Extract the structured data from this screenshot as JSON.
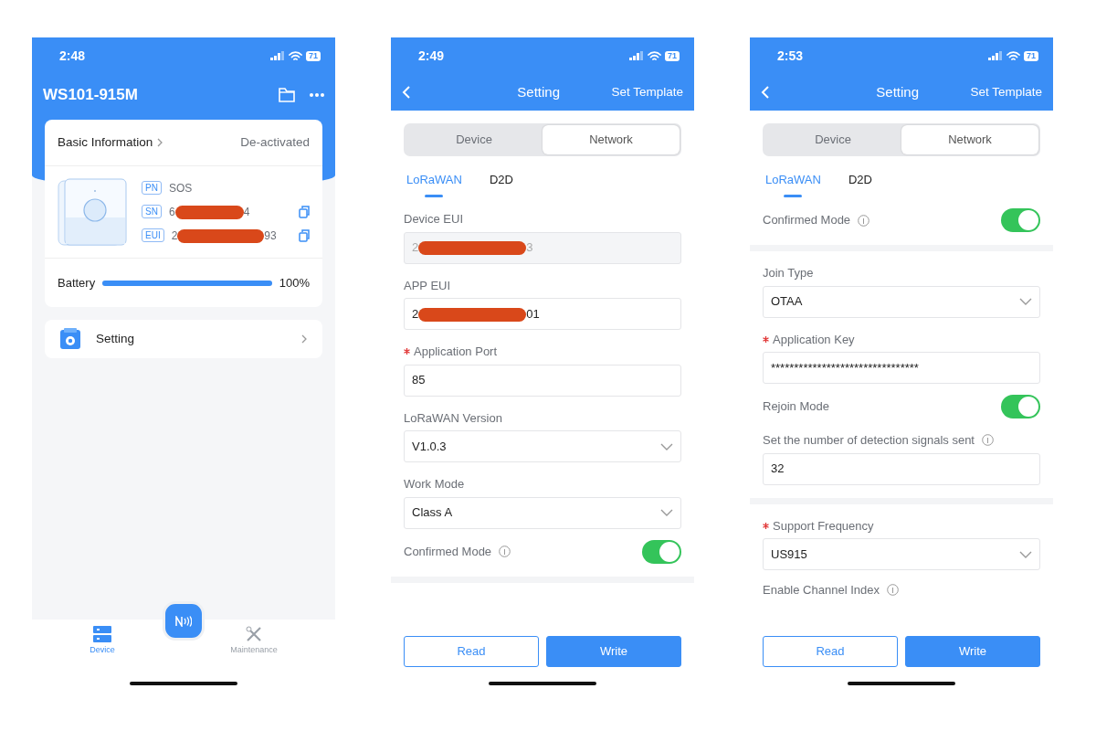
{
  "screens": [
    {
      "kind": "device",
      "status_bar": {
        "time": "2:48",
        "battery": "71"
      },
      "title": "WS101-915M",
      "info_card": {
        "heading": "Basic Information",
        "state": "De-activated",
        "fields": [
          {
            "tag": "PN",
            "value": "SOS",
            "copyable": false
          },
          {
            "tag": "SN",
            "redacted_value": {
              "start": "6",
              "end": "4"
            },
            "copyable": true
          },
          {
            "tag": "EUI",
            "redacted_value": {
              "start": "2",
              "end": "93"
            },
            "copyable": true
          }
        ],
        "battery": {
          "label": "Battery",
          "level": 1.0,
          "reading": "100%"
        }
      },
      "menu": [
        {
          "label": "Setting"
        }
      ],
      "tab_bar": [
        {
          "label": "Device",
          "selected": true
        },
        {
          "label": "Maintenance",
          "selected": false
        }
      ]
    },
    {
      "kind": "setting",
      "status_bar": {
        "time": "2:49",
        "battery": "71"
      },
      "title": "Setting",
      "action": "Set Template",
      "segments": [
        {
          "label": "Device",
          "selected": false
        },
        {
          "label": "Network",
          "selected": true
        }
      ],
      "subtabs": [
        {
          "label": "LoRaWAN",
          "selected": true
        },
        {
          "label": "D2D",
          "selected": false
        }
      ],
      "rows": [
        {
          "kind": "input",
          "label": "Device EUI",
          "required": false,
          "disabled": true,
          "redacted_value": {
            "start": "2",
            "end": "3"
          }
        },
        {
          "kind": "input",
          "label": "APP EUI",
          "required": false,
          "disabled": false,
          "redacted_value": {
            "start": "2",
            "end": "01"
          }
        },
        {
          "kind": "input",
          "label": "Application Port",
          "required": true,
          "disabled": false,
          "value": "85"
        },
        {
          "kind": "select",
          "label": "LoRaWAN Version",
          "required": false,
          "value": "V1.0.3"
        },
        {
          "kind": "select",
          "label": "Work Mode",
          "required": false,
          "value": "Class A"
        },
        {
          "kind": "toggle",
          "label": "Confirmed Mode",
          "info": true,
          "on": true
        },
        {
          "kind": "divider"
        }
      ],
      "buttons": [
        {
          "label": "Read",
          "kind": "outline"
        },
        {
          "label": "Write",
          "kind": "primary"
        }
      ]
    },
    {
      "kind": "setting",
      "status_bar": {
        "time": "2:53",
        "battery": "71"
      },
      "title": "Setting",
      "action": "Set Template",
      "segments": [
        {
          "label": "Device",
          "selected": false
        },
        {
          "label": "Network",
          "selected": true
        }
      ],
      "subtabs": [
        {
          "label": "LoRaWAN",
          "selected": true
        },
        {
          "label": "D2D",
          "selected": false
        }
      ],
      "rows": [
        {
          "kind": "toggle",
          "label": "Confirmed Mode",
          "info": true,
          "on": true
        },
        {
          "kind": "divider"
        },
        {
          "kind": "select",
          "label": "Join Type",
          "required": false,
          "value": "OTAA"
        },
        {
          "kind": "input",
          "label": "Application Key",
          "required": true,
          "disabled": false,
          "value": "********************************"
        },
        {
          "kind": "toggle",
          "label": "Rejoin Mode",
          "info": false,
          "on": true
        },
        {
          "kind": "input",
          "label": "Set the number of detection signals  sent",
          "info": true,
          "required": false,
          "disabled": false,
          "value": "32"
        },
        {
          "kind": "divider"
        },
        {
          "kind": "select",
          "label": "Support Frequency",
          "required": true,
          "value": "US915"
        },
        {
          "kind": "heading",
          "label": "Enable Channel Index",
          "info": true
        }
      ],
      "buttons": [
        {
          "label": "Read",
          "kind": "outline"
        },
        {
          "label": "Write",
          "kind": "primary"
        }
      ]
    }
  ]
}
